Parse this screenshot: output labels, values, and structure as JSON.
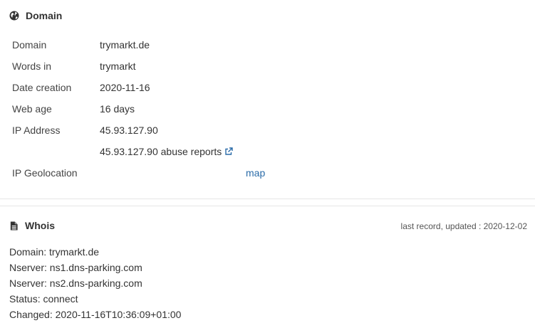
{
  "domain_panel": {
    "title": "Domain",
    "title_icon": "globe-icon",
    "rows": [
      {
        "label": "Domain",
        "value": "trymarkt.de"
      },
      {
        "label": "Words in",
        "value": "trymarkt"
      },
      {
        "label": "Date creation",
        "value": "2020-11-16"
      },
      {
        "label": "Web age",
        "value": "16 days"
      },
      {
        "label": "IP Address",
        "value": "45.93.127.90"
      }
    ],
    "abuse_link": "45.93.127.90 abuse reports",
    "abuse_icon": "external-link-icon",
    "geolocation_label": "IP Geolocation",
    "map_link": "map"
  },
  "whois_panel": {
    "title": "Whois",
    "title_icon": "document-icon",
    "updated": "last record, updated : 2020-12-02",
    "lines": [
      "Domain: trymarkt.de",
      "Nserver: ns1.dns-parking.com",
      "Nserver: ns2.dns-parking.com",
      "Status: connect",
      "Changed: 2020-11-16T10:36:09+01:00"
    ]
  },
  "colors": {
    "link": "#2a6ba8",
    "text": "#333333",
    "divider": "#e6e6e6"
  }
}
